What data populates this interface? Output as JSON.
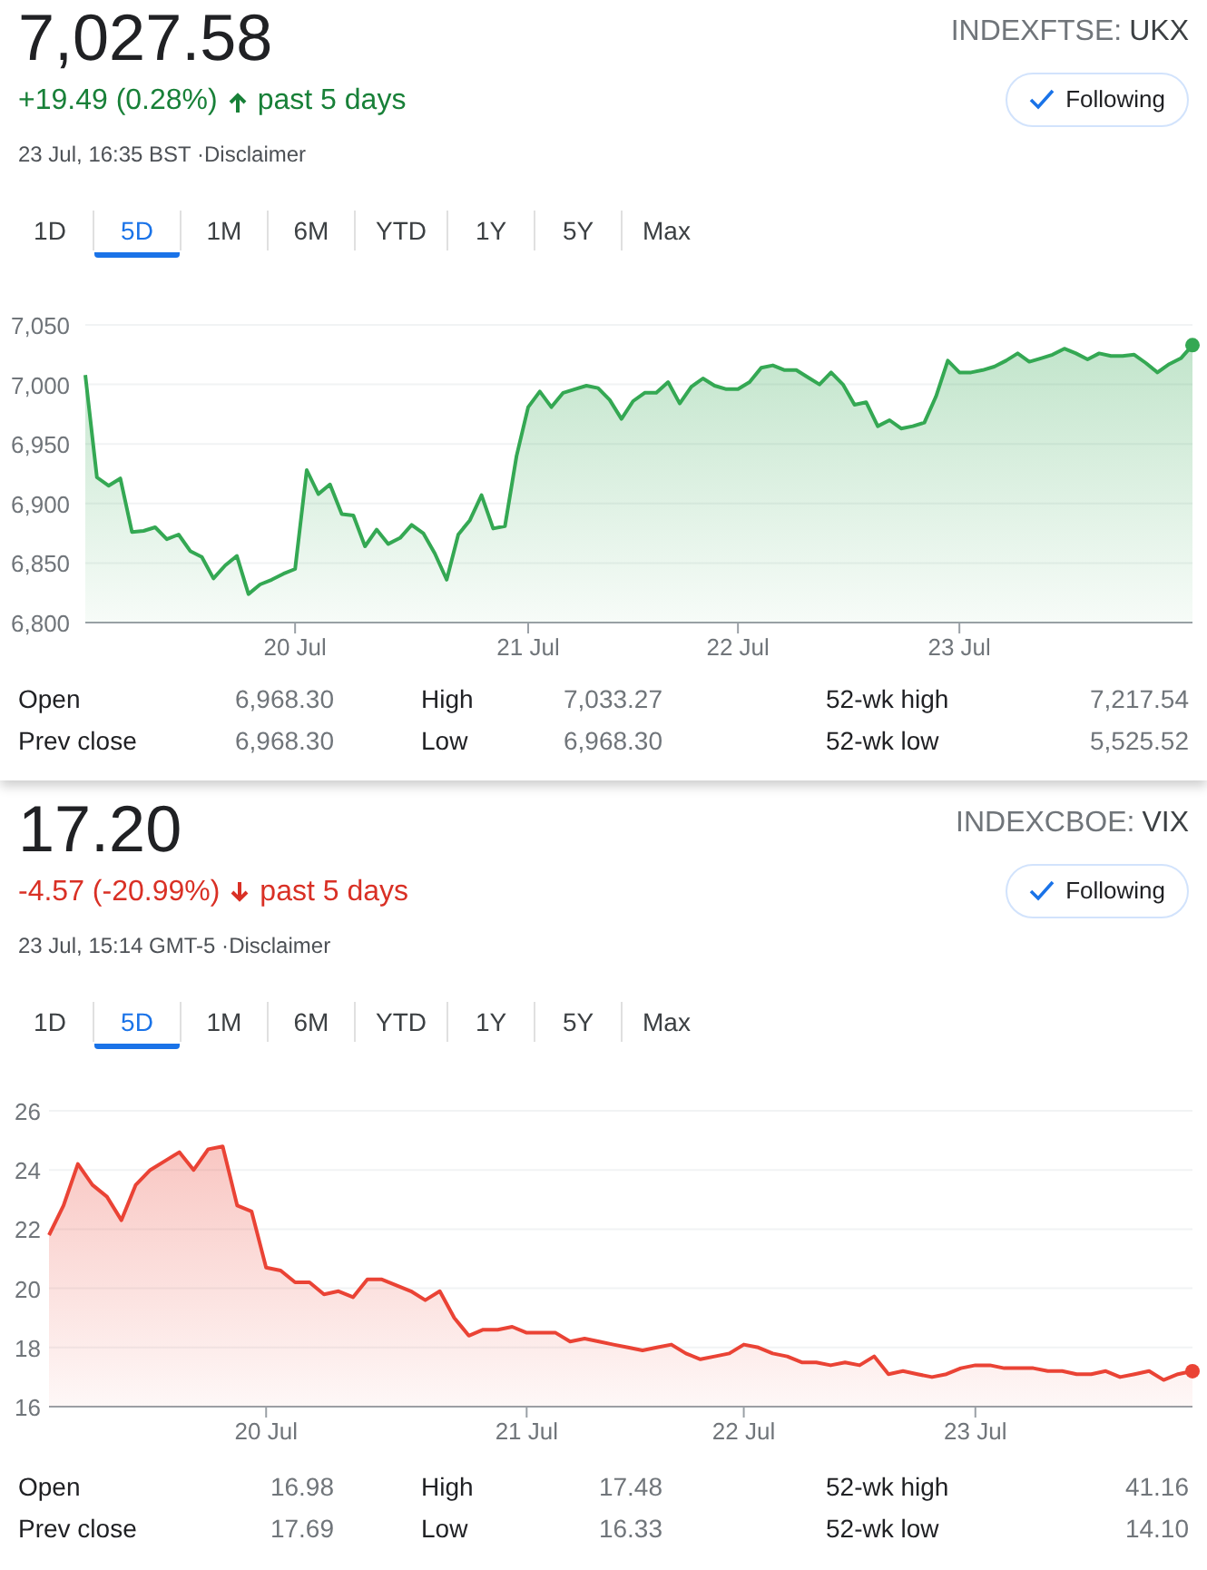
{
  "cards": [
    {
      "price": "7,027.58",
      "exchange": "INDEXFTSE:",
      "symbol": "UKX",
      "follow_button": {
        "label": "Following"
      },
      "change": {
        "text": "+19.49 (0.28%)",
        "kind": "gain",
        "period": "past 5 days"
      },
      "timestamp": "23 Jul, 16:35 BST ·",
      "disclaimer": "Disclaimer",
      "ranges": [
        {
          "label": "1D",
          "selected": false
        },
        {
          "label": "5D",
          "selected": true
        },
        {
          "label": "1M",
          "selected": false
        },
        {
          "label": "6M",
          "selected": false
        },
        {
          "label": "YTD",
          "selected": false
        },
        {
          "label": "1Y",
          "selected": false
        },
        {
          "label": "5Y",
          "selected": false
        },
        {
          "label": "Max",
          "selected": false
        }
      ],
      "chart_data": {
        "type": "area",
        "grid": true,
        "categories": [
          null,
          null,
          null,
          null,
          null,
          null,
          null,
          null,
          null,
          null,
          null,
          null,
          null,
          null,
          null,
          null,
          null,
          null,
          "20 Jul",
          null,
          null,
          null,
          null,
          null,
          null,
          null,
          null,
          null,
          null,
          null,
          null,
          null,
          null,
          null,
          null,
          null,
          null,
          null,
          "21 Jul",
          null,
          null,
          null,
          null,
          null,
          null,
          null,
          null,
          null,
          null,
          null,
          null,
          null,
          null,
          null,
          null,
          null,
          "22 Jul",
          null,
          null,
          null,
          null,
          null,
          null,
          null,
          null,
          null,
          null,
          null,
          null,
          null,
          null,
          null,
          null,
          null,
          null,
          "23 Jul",
          null,
          null,
          null,
          null,
          null,
          null,
          null,
          null,
          null,
          null,
          null,
          null,
          null,
          null,
          null,
          null,
          null,
          null,
          null,
          null
        ],
        "ylim": [
          6800,
          7050
        ],
        "yticks": [
          {
            "value": 6800,
            "label": "6,800"
          },
          {
            "value": 6850,
            "label": "6,850"
          },
          {
            "value": 6900,
            "label": "6,900"
          },
          {
            "value": 6950,
            "label": "6,950"
          },
          {
            "value": 7000,
            "label": "7,000"
          },
          {
            "value": 7050,
            "label": "7,050"
          }
        ],
        "series": [
          {
            "color": "#34a853",
            "values": [
              7008,
              6922,
              6915,
              6921,
              6876,
              6877,
              6880,
              6870,
              6874,
              6860,
              6855,
              6837,
              6848,
              6856,
              6824,
              6832,
              6836,
              6841,
              6845,
              6928,
              6908,
              6916,
              6891,
              6890,
              6864,
              6878,
              6866,
              6871,
              6882,
              6875,
              6858,
              6836,
              6874,
              6886,
              6907,
              6879,
              6881,
              6940,
              6981,
              6994,
              6981,
              6993,
              6996,
              6999,
              6997,
              6987,
              6971,
              6986,
              6993,
              6993,
              7002,
              6984,
              6998,
              7005,
              6999,
              6996,
              6996,
              7002,
              7014,
              7016,
              7012,
              7012,
              7006,
              7000,
              7010,
              7000,
              6983,
              6985,
              6965,
              6970,
              6963,
              6965,
              6968,
              6990,
              7020,
              7010,
              7010,
              7012,
              7015,
              7020,
              7026,
              7019,
              7022,
              7025,
              7030,
              7026,
              7021,
              7026,
              7024,
              7024,
              7025,
              7018,
              7010,
              7017,
              7022,
              7033
            ]
          }
        ]
      },
      "stats": [
        {
          "label": "Open",
          "value": "6,968.30"
        },
        {
          "label": "High",
          "value": "7,033.27"
        },
        {
          "label": "52-wk high",
          "value": "7,217.54"
        },
        {
          "label": "Prev close",
          "value": "6,968.30"
        },
        {
          "label": "Low",
          "value": "6,968.30"
        },
        {
          "label": "52-wk low",
          "value": "5,525.52"
        }
      ]
    },
    {
      "price": "17.20",
      "exchange": "INDEXCBOE:",
      "symbol": "VIX",
      "follow_button": {
        "label": "Following"
      },
      "change": {
        "text": "-4.57 (-20.99%)",
        "kind": "loss",
        "period": "past 5 days"
      },
      "timestamp": "23 Jul, 15:14 GMT-5 ·",
      "disclaimer": "Disclaimer",
      "ranges": [
        {
          "label": "1D",
          "selected": false
        },
        {
          "label": "5D",
          "selected": true
        },
        {
          "label": "1M",
          "selected": false
        },
        {
          "label": "6M",
          "selected": false
        },
        {
          "label": "YTD",
          "selected": false
        },
        {
          "label": "1Y",
          "selected": false
        },
        {
          "label": "5Y",
          "selected": false
        },
        {
          "label": "Max",
          "selected": false
        }
      ],
      "chart_data": {
        "type": "area",
        "grid": true,
        "categories": [
          null,
          null,
          null,
          null,
          null,
          null,
          null,
          null,
          null,
          null,
          null,
          null,
          null,
          null,
          null,
          "20 Jul",
          null,
          null,
          null,
          null,
          null,
          null,
          null,
          null,
          null,
          null,
          null,
          null,
          null,
          null,
          null,
          null,
          null,
          "21 Jul",
          null,
          null,
          null,
          null,
          null,
          null,
          null,
          null,
          null,
          null,
          null,
          null,
          null,
          null,
          "22 Jul",
          null,
          null,
          null,
          null,
          null,
          null,
          null,
          null,
          null,
          null,
          null,
          null,
          null,
          null,
          null,
          "23 Jul",
          null,
          null,
          null,
          null,
          null,
          null,
          null,
          null,
          null,
          null,
          null,
          null,
          null,
          null,
          null
        ],
        "ylim": [
          16,
          26
        ],
        "yticks": [
          16,
          18,
          20,
          22,
          24,
          26
        ],
        "series": [
          {
            "color": "#ea4335",
            "values": [
              21.8,
              22.8,
              24.2,
              23.5,
              23.1,
              22.3,
              23.5,
              24.0,
              24.3,
              24.6,
              24.0,
              24.7,
              24.8,
              22.8,
              22.6,
              20.7,
              20.6,
              20.2,
              20.2,
              19.8,
              19.9,
              19.7,
              20.3,
              20.3,
              20.1,
              19.9,
              19.6,
              19.9,
              19.0,
              18.4,
              18.6,
              18.6,
              18.7,
              18.5,
              18.5,
              18.5,
              18.2,
              18.3,
              18.2,
              18.1,
              18.0,
              17.9,
              18.0,
              18.1,
              17.8,
              17.6,
              17.7,
              17.8,
              18.1,
              18.0,
              17.8,
              17.7,
              17.5,
              17.5,
              17.4,
              17.5,
              17.4,
              17.7,
              17.1,
              17.2,
              17.1,
              17.0,
              17.1,
              17.3,
              17.4,
              17.4,
              17.3,
              17.3,
              17.3,
              17.2,
              17.2,
              17.1,
              17.1,
              17.2,
              17.0,
              17.1,
              17.2,
              16.9,
              17.1,
              17.2
            ]
          }
        ]
      },
      "stats": [
        {
          "label": "Open",
          "value": "16.98"
        },
        {
          "label": "High",
          "value": "17.48"
        },
        {
          "label": "52-wk high",
          "value": "41.16"
        },
        {
          "label": "Prev close",
          "value": "17.69"
        },
        {
          "label": "Low",
          "value": "16.33"
        },
        {
          "label": "52-wk low",
          "value": "14.10"
        }
      ]
    }
  ]
}
